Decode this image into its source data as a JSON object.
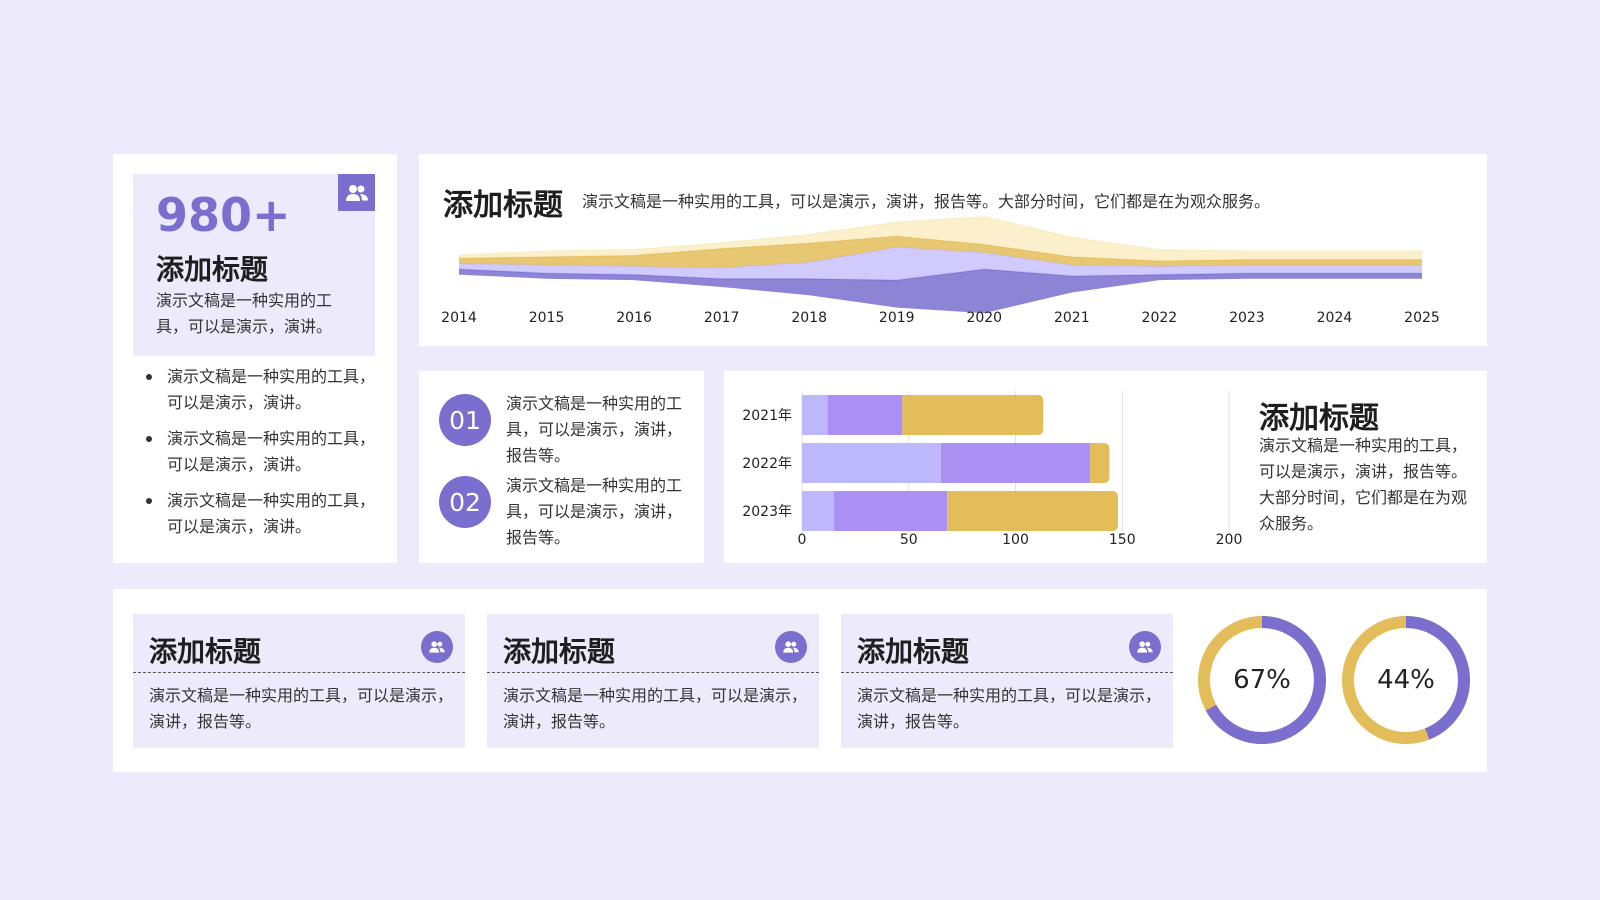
{
  "stat_card": {
    "value": "980+",
    "title": "添加标题",
    "desc": "演示文稿是一种实用的工具，可以是演示，演讲。",
    "icon": "users-icon",
    "bullets": [
      "演示文稿是一种实用的工具，可以是演示，演讲。",
      "演示文稿是一种实用的工具，可以是演示，演讲。",
      "演示文稿是一种实用的工具，可以是演示，演讲。"
    ]
  },
  "stream_card": {
    "title": "添加标题",
    "desc": "演示文稿是一种实用的工具，可以是演示，演讲，报告等。大部分时间，它们都是在为观众服务。"
  },
  "numbered": [
    {
      "num": "01",
      "text": "演示文稿是一种实用的工具，可以是演示，演讲，报告等。"
    },
    {
      "num": "02",
      "text": "演示文稿是一种实用的工具，可以是演示，演讲，报告等。"
    }
  ],
  "bar_side": {
    "title": "添加标题",
    "desc": "演示文稿是一种实用的工具，可以是演示，演讲，报告等。大部分时间，它们都是在为观众服务。"
  },
  "features": [
    {
      "title": "添加标题",
      "desc": "演示文稿是一种实用的工具，可以是演示，演讲，报告等。",
      "icon": "users-icon"
    },
    {
      "title": "添加标题",
      "desc": "演示文稿是一种实用的工具，可以是演示，演讲，报告等。",
      "icon": "users-icon"
    },
    {
      "title": "添加标题",
      "desc": "演示文稿是一种实用的工具，可以是演示，演讲，报告等。",
      "icon": "users-icon"
    }
  ],
  "colors": {
    "purple": "#7a6fcf",
    "lavender": "#bdb7fb",
    "violet": "#ab8ff2",
    "gold": "#e4bd5b",
    "background": "#edebfb"
  },
  "chart_data": [
    {
      "type": "area",
      "subtype": "streamgraph",
      "x": [
        "2014",
        "2015",
        "2016",
        "2017",
        "2018",
        "2019",
        "2020",
        "2021",
        "2022",
        "2023",
        "2024",
        "2025"
      ],
      "series": [
        {
          "values": [
            1,
            1,
            1,
            1.5,
            3,
            5,
            8,
            3,
            1,
            1,
            1,
            1
          ],
          "color": "#7a6fcf"
        },
        {
          "values": [
            1,
            1.5,
            1.5,
            2,
            3,
            6,
            3,
            2,
            1.5,
            1.5,
            1.5,
            1.5
          ],
          "color": "#c9c1fb"
        },
        {
          "values": [
            1,
            1.5,
            2,
            3.5,
            3.5,
            2,
            1.5,
            1.5,
            1,
            1,
            1,
            1
          ],
          "color": "#e4bd5b"
        },
        {
          "values": [
            0.5,
            1,
            1,
            1,
            1.5,
            2.5,
            5,
            3.5,
            2,
            1.5,
            1.5,
            1.5
          ],
          "color": "#fbedc3"
        }
      ]
    },
    {
      "type": "bar",
      "orientation": "horizontal",
      "stacked": true,
      "categories": [
        "2021年",
        "2022年",
        "2023年"
      ],
      "series": [
        {
          "values": [
            12,
            65,
            15
          ],
          "color": "#bdb7fb"
        },
        {
          "values": [
            35,
            70,
            53
          ],
          "color": "#ab8ff2"
        },
        {
          "values": [
            66,
            9,
            80
          ],
          "color": "#e4bd5b"
        }
      ],
      "xlim": [
        0,
        200
      ],
      "xticks": [
        0,
        50,
        100,
        150,
        200
      ]
    },
    {
      "type": "pie",
      "subtype": "donut",
      "label": "67%",
      "value": 67,
      "colors": {
        "value": "#7a6fcf",
        "rest": "#e4bd5b"
      }
    },
    {
      "type": "pie",
      "subtype": "donut",
      "label": "44%",
      "value": 44,
      "colors": {
        "value": "#7a6fcf",
        "rest": "#e4bd5b"
      }
    }
  ]
}
